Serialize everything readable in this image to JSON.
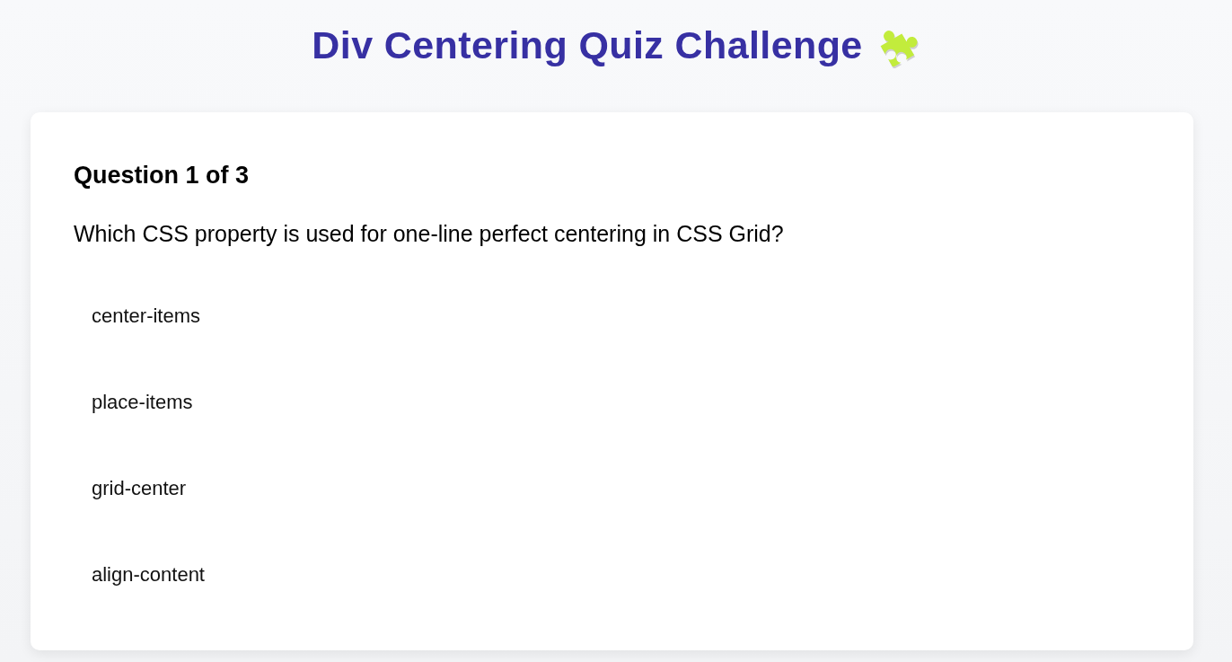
{
  "title": "Div Centering Quiz Challenge",
  "quiz": {
    "progress": "Question 1 of 3",
    "question": "Which CSS property is used for one-line perfect centering in CSS Grid?",
    "options": [
      {
        "label": "center-items",
        "selected": false
      },
      {
        "label": "place-items",
        "selected": false
      },
      {
        "label": "grid-center",
        "selected": false
      },
      {
        "label": "align-content",
        "selected": false
      }
    ]
  }
}
